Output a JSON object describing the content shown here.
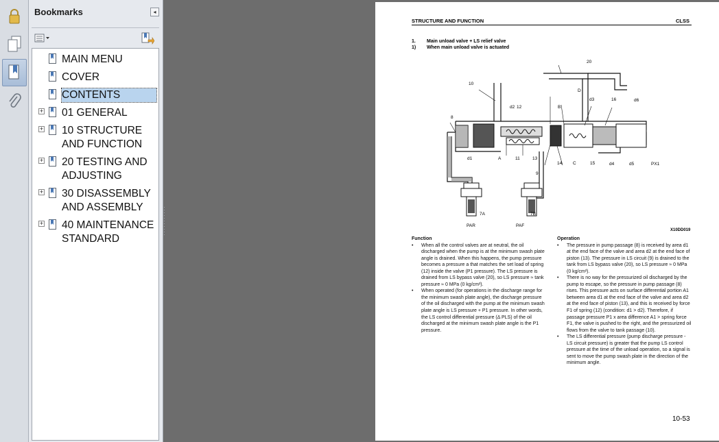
{
  "panel": {
    "title": "Bookmarks",
    "bookmarks": [
      {
        "label": "MAIN MENU",
        "expandable": false,
        "selected": false
      },
      {
        "label": "COVER",
        "expandable": false,
        "selected": false
      },
      {
        "label": "CONTENTS",
        "expandable": false,
        "selected": true
      },
      {
        "label": "01 GENERAL",
        "expandable": true,
        "selected": false
      },
      {
        "label": "10 STRUCTURE AND FUNCTION",
        "expandable": true,
        "selected": false
      },
      {
        "label": "20 TESTING AND ADJUSTING",
        "expandable": true,
        "selected": false
      },
      {
        "label": "30 DISASSEMBLY AND ASSEMBLY",
        "expandable": true,
        "selected": false
      },
      {
        "label": "40 MAINTENANCE STANDARD",
        "expandable": true,
        "selected": false
      }
    ]
  },
  "rail": {
    "icons": [
      "lock-icon",
      "pages-icon",
      "bookmarks-icon",
      "attachments-icon"
    ]
  },
  "page": {
    "header_left": "STRUCTURE AND FUNCTION",
    "header_right": "CLSS",
    "section_num": "1.",
    "section_title": "Main unload valve + LS relief valve",
    "sub_num": "1)",
    "sub_title": "When main unload valve is actuated",
    "figure_id": "X10DD019",
    "diagram_labels": {
      "n20": "20",
      "n10": "10",
      "D": "D",
      "d3": "d3",
      "n16": "16",
      "d6": "d6",
      "d2": "d2",
      "n12": "12",
      "B": "B",
      "n8": "8",
      "d1": "d1",
      "A": "A",
      "n11": "11",
      "n13": "13",
      "n14": "14",
      "C": "C",
      "n15": "15",
      "d4": "d4",
      "d5": "d5",
      "PX1": "PX1",
      "n9": "9",
      "n7A": "7A",
      "n7B": "7B",
      "PAR": "PAR",
      "PAF": "PAF"
    },
    "function_title": "Function",
    "function_items": [
      "When all the control valves are at neutral, the oil discharged when the pump is at the minimum swash plate angle is drained. When this happens, the pump pressure becomes a pressure a that matches the set load of spring (12) inside the valve (P1 pressure). The LS pressure is drained from LS bypass valve (20), so LS pressure ≈ tank pressure ≈ 0 MPa (0 kg/cm²).",
      "When operated (for operations in the discharge range for the minimum swash plate angle), the discharge pressure of the oil discharged with the pump at the minimum swash plate angle is LS pressure + P1 pressure. In other words, the LS control differential pressure (Δ PLS) of the oil discharged at the minimum swash plate angle is the P1 pressure."
    ],
    "operation_title": "Operation",
    "operation_items": [
      "The pressure in pump passage (8) is received by area d1 at the end face of the valve and area d2 at the end face of piston (13). The pressure in LS circuit (9) is drained to the tank from LS bypass valve (20), so LS pressure ≈ 0 MPa (0 kg/cm²).",
      "There is no way for the pressurized oil discharged by the pump to escape, so the pressure in pump passage (8) rises. This pressure acts on surface differential portion A1 between area d1 at the end face of the valve and area d2 at the end face of piston (13), and this is received by force F1 of spring (12) (condition: d1 > d2). Therefore, if passage pressure P1 x area difference A1 > spring force F1, the valve is pushed to the right, and the pressurized oil flows from the valve to tank passage (10).",
      "The LS differential pressure (pump discharge pressure - LS circuit pressure) is greater that the pump LS control pressure at the time of the unload operation, so a signal is sent to move the pump swash plate in the direction of the minimum angle."
    ],
    "page_number": "10-53"
  }
}
